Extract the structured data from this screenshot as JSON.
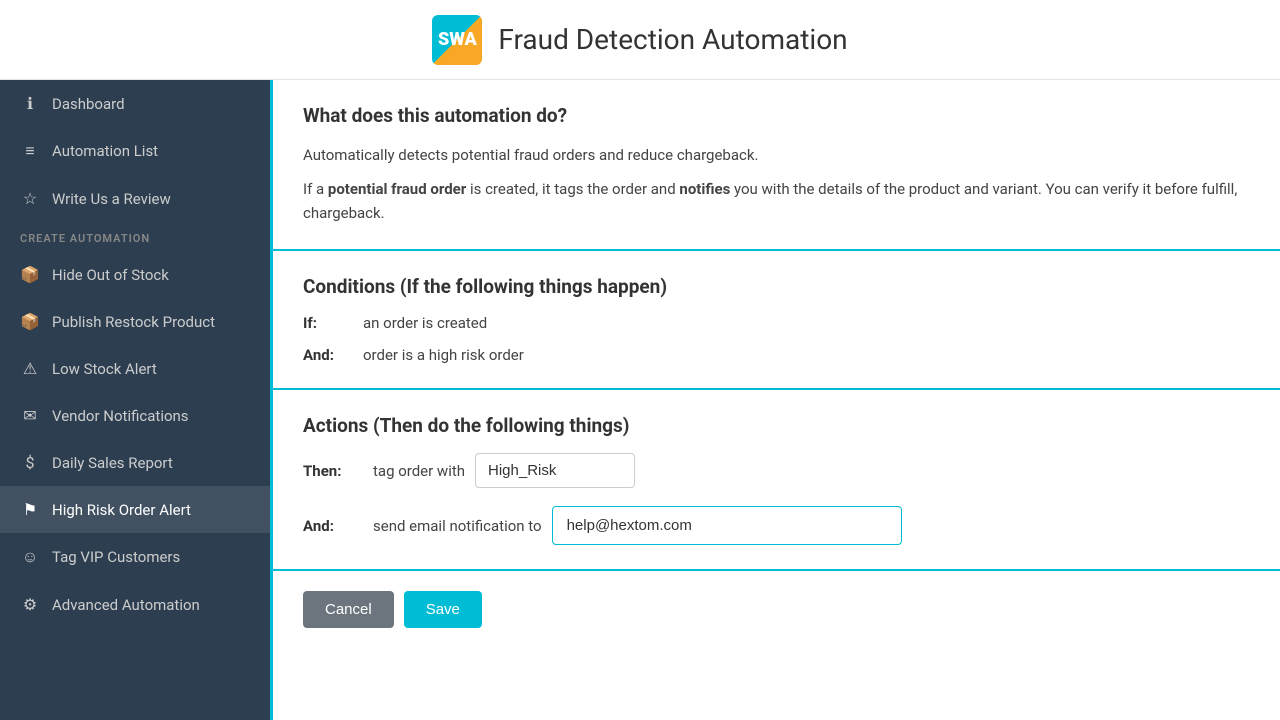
{
  "header": {
    "logo_text": "SWA",
    "title": "Fraud Detection Automation"
  },
  "sidebar": {
    "items": [
      {
        "id": "dashboard",
        "icon": "ℹ",
        "label": "Dashboard",
        "active": false
      },
      {
        "id": "automation-list",
        "icon": "☰",
        "label": "Automation List",
        "active": false
      },
      {
        "id": "write-review",
        "icon": "☆",
        "label": "Write Us a Review",
        "active": false
      }
    ],
    "section_label": "CREATE AUTOMATION",
    "create_items": [
      {
        "id": "hide-out-of-stock",
        "icon": "☐",
        "label": "Hide Out of Stock",
        "active": false
      },
      {
        "id": "publish-restock",
        "icon": "☐",
        "label": "Publish Restock Product",
        "active": false
      },
      {
        "id": "low-stock-alert",
        "icon": "⚠",
        "label": "Low Stock Alert",
        "active": false
      },
      {
        "id": "vendor-notifications",
        "icon": "✉",
        "label": "Vendor Notifications",
        "active": false
      },
      {
        "id": "daily-sales-report",
        "icon": "$",
        "label": "Daily Sales Report",
        "active": false
      },
      {
        "id": "high-risk-order-alert",
        "icon": "⬛",
        "label": "High Risk Order Alert",
        "active": true
      },
      {
        "id": "tag-vip-customers",
        "icon": "☺",
        "label": "Tag VIP Customers",
        "active": false
      },
      {
        "id": "advanced-automation",
        "icon": "⚙",
        "label": "Advanced Automation",
        "active": false
      }
    ]
  },
  "content": {
    "what_section": {
      "title": "What does this automation do?",
      "body1": "Automatically detects potential fraud orders and reduce chargeback.",
      "body2_before": "If a ",
      "body2_bold1": "potential fraud order",
      "body2_mid": " is created, it tags the order and ",
      "body2_bold2": "notifies",
      "body2_after": " you with the details of the product and variant. You can verify it before fulfill, chargeback."
    },
    "conditions_section": {
      "title": "Conditions (If the following things happen)",
      "if_label": "If:",
      "if_value": "an order is created",
      "and_label": "And:",
      "and_value": "order is a high risk order"
    },
    "actions_section": {
      "title": "Actions (Then do the following things)",
      "then_label": "Then:",
      "then_text": "tag order with",
      "tag_value": "High_Risk",
      "and_label": "And:",
      "and_text": "send email notification to",
      "email_value": "help@hextom.com"
    },
    "buttons": {
      "cancel": "Cancel",
      "save": "Save"
    }
  }
}
